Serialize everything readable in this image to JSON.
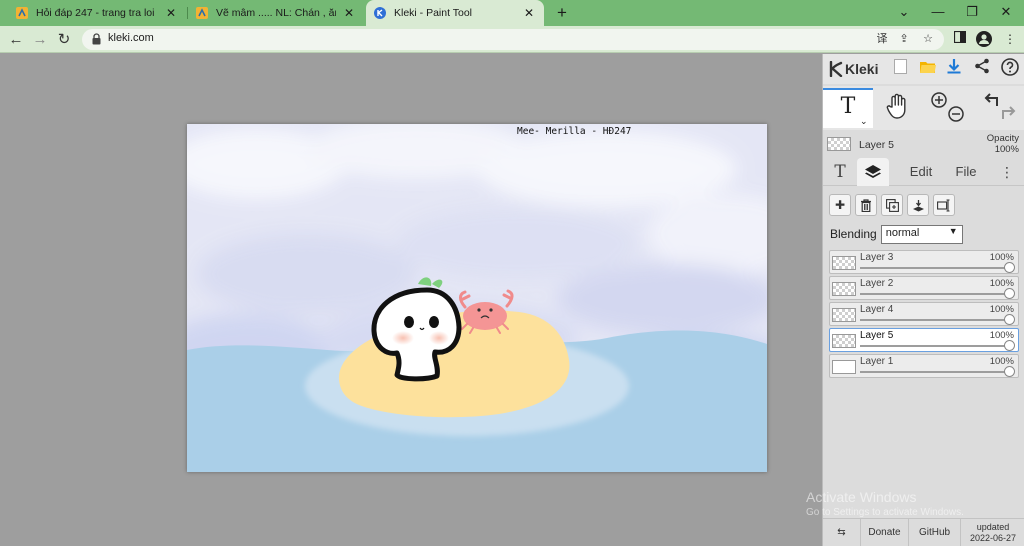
{
  "browser": {
    "tabs": [
      {
        "title": "Hỏi đáp 247 - trang tra loi",
        "active": false
      },
      {
        "title": "Vẽ mâm ..... NL: Chán , ăn bắp kẹo",
        "active": false
      },
      {
        "title": "Kleki - Paint Tool",
        "active": true
      }
    ],
    "url": "kleki.com",
    "colors": {
      "tabbar": "#74b974",
      "toolbar": "#d9ead3"
    }
  },
  "canvas": {
    "credit_text": "Mee- Merilla - HĐ247",
    "colors": {
      "sky": "#e6e8f6",
      "sea": "#aacfe8",
      "sand": "#fde19c",
      "crab": "#f49595",
      "sprout": "#7ed07e"
    }
  },
  "app": {
    "name": "Kleki",
    "active_layer": {
      "name": "Layer 5",
      "opacity_label": "Opacity",
      "opacity_value": "100%"
    },
    "subtabs": {
      "edit": "Edit",
      "file": "File"
    },
    "blending_label": "Blending",
    "blending_value": "normal",
    "layers": [
      {
        "name": "Layer 3",
        "opacity": "100%",
        "selected": false
      },
      {
        "name": "Layer 2",
        "opacity": "100%",
        "selected": false
      },
      {
        "name": "Layer 4",
        "opacity": "100%",
        "selected": false
      },
      {
        "name": "Layer 5",
        "opacity": "100%",
        "selected": true
      },
      {
        "name": "Layer 1",
        "opacity": "100%",
        "selected": false
      }
    ],
    "footer": {
      "donate": "Donate",
      "github": "GitHub",
      "updated_label": "updated",
      "updated_date": "2022-06-27"
    }
  },
  "os": {
    "watermark_title": "Activate Windows",
    "watermark_sub": "Go to Settings to activate Windows."
  }
}
